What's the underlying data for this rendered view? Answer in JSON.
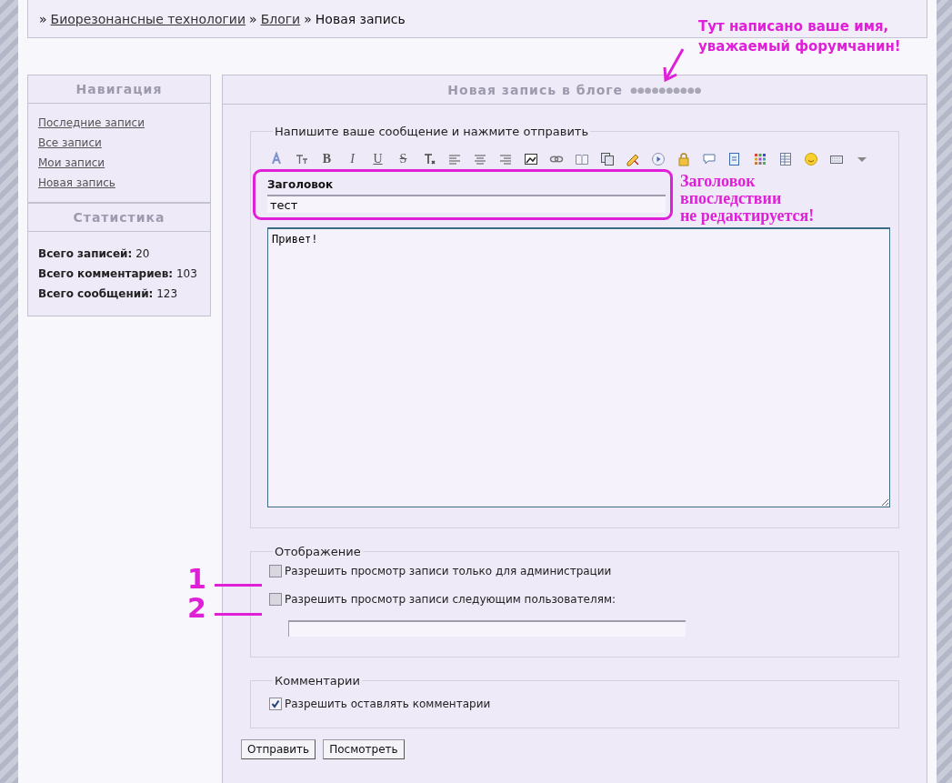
{
  "breadcrumb": [
    {
      "separator": "»",
      "label": "Биорезонансные технологии",
      "link": true
    },
    {
      "separator": "»",
      "label": "Блоги",
      "link": true
    },
    {
      "separator": "»",
      "label": "Новая запись",
      "link": false
    }
  ],
  "sidebar": [
    {
      "title": "Навигация",
      "kind": "links",
      "items": [
        "Последние записи",
        "Все записи",
        "Мои записи",
        "Новая запись"
      ]
    },
    {
      "title": "Статистика",
      "kind": "stats",
      "items": [
        {
          "label": "Всего записей:",
          "value": "20"
        },
        {
          "label": "Всего комментариев:",
          "value": "103"
        },
        {
          "label": "Всего сообщений:",
          "value": "123"
        }
      ]
    }
  ],
  "panel": {
    "title": "Новая запись в блоге",
    "username": "●●●●●●●●●●"
  },
  "compose": {
    "legend": "Напишите ваше сообщение и нажмите отправить",
    "toolbar": [
      {
        "kind": "font-color"
      },
      {
        "kind": "font-size"
      },
      {
        "kind": "bold",
        "label": "B"
      },
      {
        "kind": "italic",
        "label": "I"
      },
      {
        "kind": "underline",
        "label": "U"
      },
      {
        "kind": "strike",
        "label": "S"
      },
      {
        "kind": "clear"
      },
      {
        "kind": "align-left"
      },
      {
        "kind": "align-center"
      },
      {
        "kind": "align-right"
      },
      {
        "kind": "image"
      },
      {
        "kind": "link"
      },
      {
        "kind": "book"
      },
      {
        "kind": "copy"
      },
      {
        "kind": "pencil"
      },
      {
        "kind": "play"
      },
      {
        "kind": "lock"
      },
      {
        "kind": "bubble"
      },
      {
        "kind": "document"
      },
      {
        "kind": "grid"
      },
      {
        "kind": "table"
      },
      {
        "kind": "smiley"
      },
      {
        "kind": "keyboard"
      },
      {
        "kind": "dropdown"
      }
    ],
    "title_label": "Заголовок",
    "title_value": "тест",
    "body_value": "Привет!"
  },
  "display": {
    "legend": "Отображение",
    "options": [
      {
        "label": "Разрешить просмотр записи только для администрации",
        "checked": false
      },
      {
        "label": "Разрешить просмотр записи следующим пользователям:",
        "checked": false
      }
    ]
  },
  "comments": {
    "legend": "Комментарии",
    "options": [
      {
        "label": "Разрешить оставлять комментарии",
        "checked": true
      }
    ]
  },
  "buttons": [
    "Отправить",
    "Посмотреть"
  ],
  "annotations": {
    "name_note": [
      "Тут написано ваше имя,",
      "уважаемый форумчанин!"
    ],
    "title_note": [
      "Заголовок",
      "впоследствии",
      "не редактируется!"
    ],
    "markers": [
      "1",
      "2"
    ]
  }
}
